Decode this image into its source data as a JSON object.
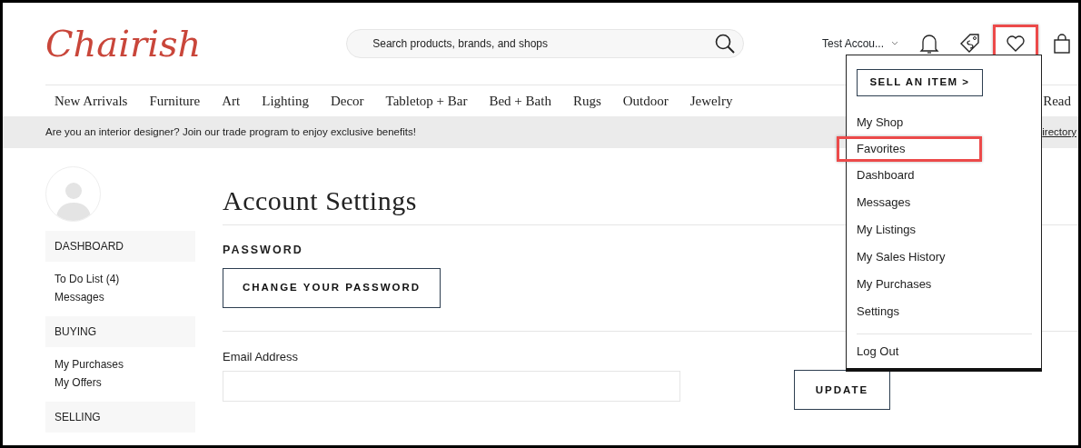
{
  "logo": {
    "text": "Chairish"
  },
  "search": {
    "placeholder": "Search products, brands, and shops"
  },
  "account": {
    "label": "Test Accou..."
  },
  "header_icons": [
    {
      "kind": "bell",
      "highlighted": false
    },
    {
      "kind": "tag",
      "highlighted": false
    },
    {
      "kind": "heart",
      "highlighted": true
    },
    {
      "kind": "bag",
      "highlighted": false
    }
  ],
  "nav": [
    "New Arrivals",
    "Furniture",
    "Art",
    "Lighting",
    "Decor",
    "Tabletop + Bar",
    "Bed + Bath",
    "Rugs",
    "Outdoor",
    "Jewelry",
    "Read"
  ],
  "banner": {
    "before": "Are you an interior designer? ",
    "link": "Join our trade program",
    "after": " to enjoy exclusive benefits!",
    "right_link": "irectory"
  },
  "sidebar": {
    "sections": [
      {
        "heading": "DASHBOARD",
        "links": [
          "To Do List (4)",
          "Messages"
        ]
      },
      {
        "heading": "BUYING",
        "links": [
          "My Purchases",
          "My Offers"
        ]
      },
      {
        "heading": "SELLING"
      }
    ]
  },
  "main": {
    "title": "Account Settings",
    "password_heading": "PASSWORD",
    "password_button": "CHANGE YOUR PASSWORD",
    "email_label": "Email Address",
    "update_button": "UPDATE"
  },
  "dropdown": {
    "sell_button": "SELL AN ITEM >",
    "items": [
      {
        "label": "My Shop",
        "highlighted": false
      },
      {
        "label": "Favorites",
        "highlighted": true
      },
      {
        "label": "Dashboard",
        "highlighted": false
      },
      {
        "label": "Messages",
        "highlighted": false
      },
      {
        "label": "My Listings",
        "highlighted": false
      },
      {
        "label": "My Sales History",
        "highlighted": false
      },
      {
        "label": "My Purchases",
        "highlighted": false
      },
      {
        "label": "Settings",
        "highlighted": false
      }
    ],
    "logout": "Log Out"
  }
}
